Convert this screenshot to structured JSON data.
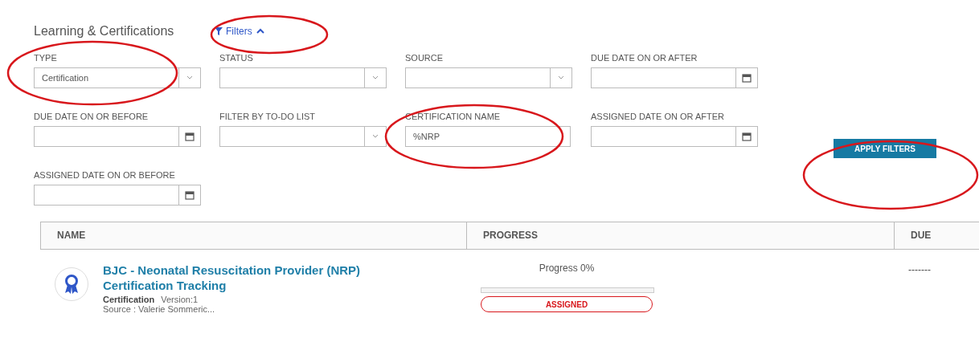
{
  "page": {
    "title": "Learning & Certifications"
  },
  "filters_toggle": {
    "label": "Filters",
    "expanded": true
  },
  "filters": [
    {
      "kind": "select",
      "label": "TYPE",
      "value": "Certification"
    },
    {
      "kind": "select",
      "label": "STATUS"
    },
    {
      "kind": "select",
      "label": "SOURCE"
    },
    {
      "kind": "date",
      "label": "DUE DATE ON OR AFTER"
    },
    {
      "kind": "date",
      "label": "DUE DATE ON OR BEFORE"
    },
    {
      "kind": "select",
      "label": "FILTER BY TO-DO LIST"
    },
    {
      "kind": "text",
      "label": "CERTIFICATION NAME",
      "value": "%NRP"
    },
    {
      "kind": "date",
      "label": "ASSIGNED DATE ON OR AFTER"
    },
    {
      "kind": "date",
      "label": "ASSIGNED DATE ON OR BEFORE"
    }
  ],
  "apply_button": "APPLY FILTERS",
  "table": {
    "columns": [
      "NAME",
      "PROGRESS",
      "DUE"
    ],
    "rows": [
      {
        "title": "BJC - Neonatal Resuscitation Provider (NRP) Certification Tracking",
        "type": "Certification",
        "version": "Version:1",
        "source": "Source : Valerie Sommeric...",
        "progress_text": "Progress 0%",
        "level": 0,
        "status": "ASSIGNED",
        "due": "-------"
      }
    ]
  }
}
